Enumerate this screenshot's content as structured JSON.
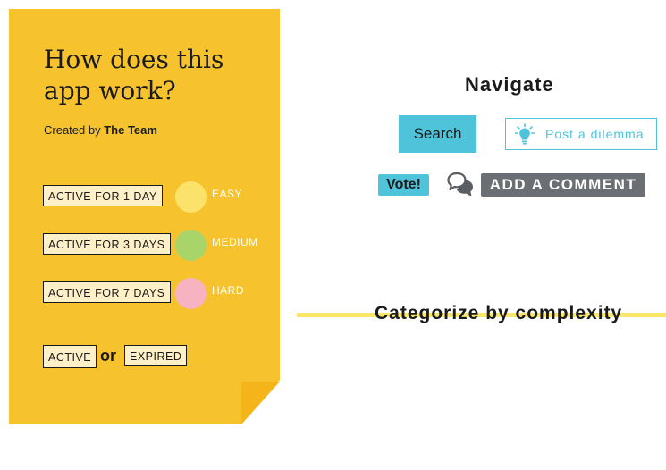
{
  "card": {
    "title": "How does this app work?",
    "credit_prefix": "Created by",
    "credit_name": "The Team",
    "durations": [
      {
        "label": "ACTIVE FOR 1 DAY"
      },
      {
        "label": "ACTIVE FOR 3 DAYS"
      },
      {
        "label": "ACTIVE FOR 7 DAYS"
      }
    ],
    "difficulties": [
      {
        "label": "EASY",
        "color": "#fbe36b"
      },
      {
        "label": "MEDIUM",
        "color": "#a8d46a"
      },
      {
        "label": "HARD",
        "color": "#f7b3c2"
      }
    ],
    "status": {
      "active": "ACTIVE",
      "or": "or",
      "expired": "EXPIRED"
    },
    "background_color": "#f6c32f"
  },
  "navigate": {
    "title": "Navigate",
    "search_label": "Search",
    "post_label": "Post a dilemma",
    "vote_label": "Vote!",
    "comment_label": "ADD A COMMENT",
    "icons": [
      "lightbulb-icon",
      "comment-bubbles-icon"
    ]
  },
  "categorize": {
    "text": "Categorize by complexity",
    "highlight_color": "#f9e66b"
  },
  "colors": {
    "accent": "#4ec3d9",
    "comment_button": "#6b6e73"
  }
}
